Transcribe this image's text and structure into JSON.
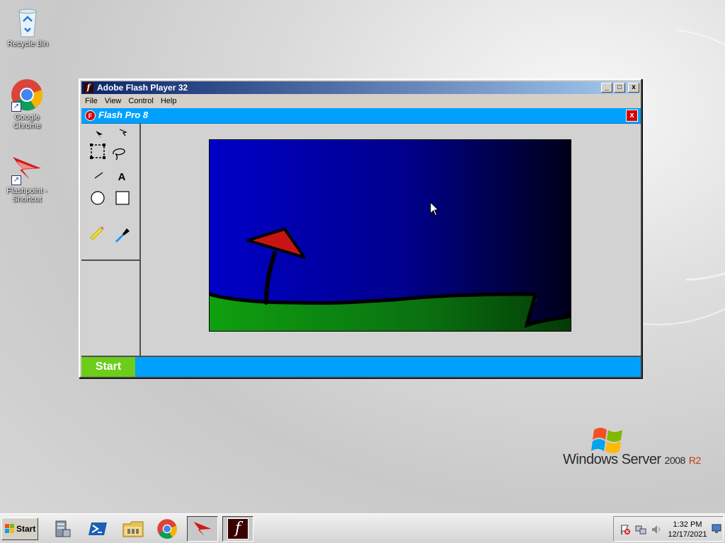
{
  "desktop": {
    "icons": [
      {
        "label": "Recycle Bin",
        "icon": "recycle-bin-icon"
      },
      {
        "label": "Google Chrome",
        "icon": "chrome-icon"
      },
      {
        "label": "Flashpoint - Shortcut",
        "icon": "flashpoint-icon"
      }
    ],
    "wallpaper_logo": {
      "brand": "Windows Server",
      "version": "2008",
      "edition": "R2"
    }
  },
  "flash_player_window": {
    "title": "Adobe Flash Player 32",
    "menu": [
      "File",
      "View",
      "Control",
      "Help"
    ],
    "controls": {
      "minimize": "_",
      "maximize": "□",
      "close": "x"
    }
  },
  "flash_pro": {
    "title": "Flash Pro 8",
    "logo_letter": "F",
    "close_label": "x",
    "start_label": "Start",
    "tools": [
      "selection-arrow",
      "subselection-arrow",
      "free-transform",
      "lasso",
      "line",
      "text",
      "oval",
      "rectangle",
      "pencil",
      "brush"
    ],
    "text_tool_label": "A",
    "stage": {
      "sky_top": "#0000c8",
      "sky_bottom": "#000018",
      "ground": "#0a9a0a",
      "flag": "#c81414",
      "outline": "#000000"
    }
  },
  "taskbar": {
    "start_label": "Start",
    "pinned": [
      "server-manager-icon",
      "powershell-icon",
      "explorer-icon",
      "chrome-icon",
      "flashpoint-icon",
      "flash-player-icon"
    ],
    "clock": {
      "time": "1:32 PM",
      "date": "12/17/2021"
    }
  },
  "colors": {
    "flash_pro_bar": "#00a0ff",
    "start_green": "#6ccd1a",
    "close_red": "#d40000",
    "title_blue": "#0a246a"
  }
}
